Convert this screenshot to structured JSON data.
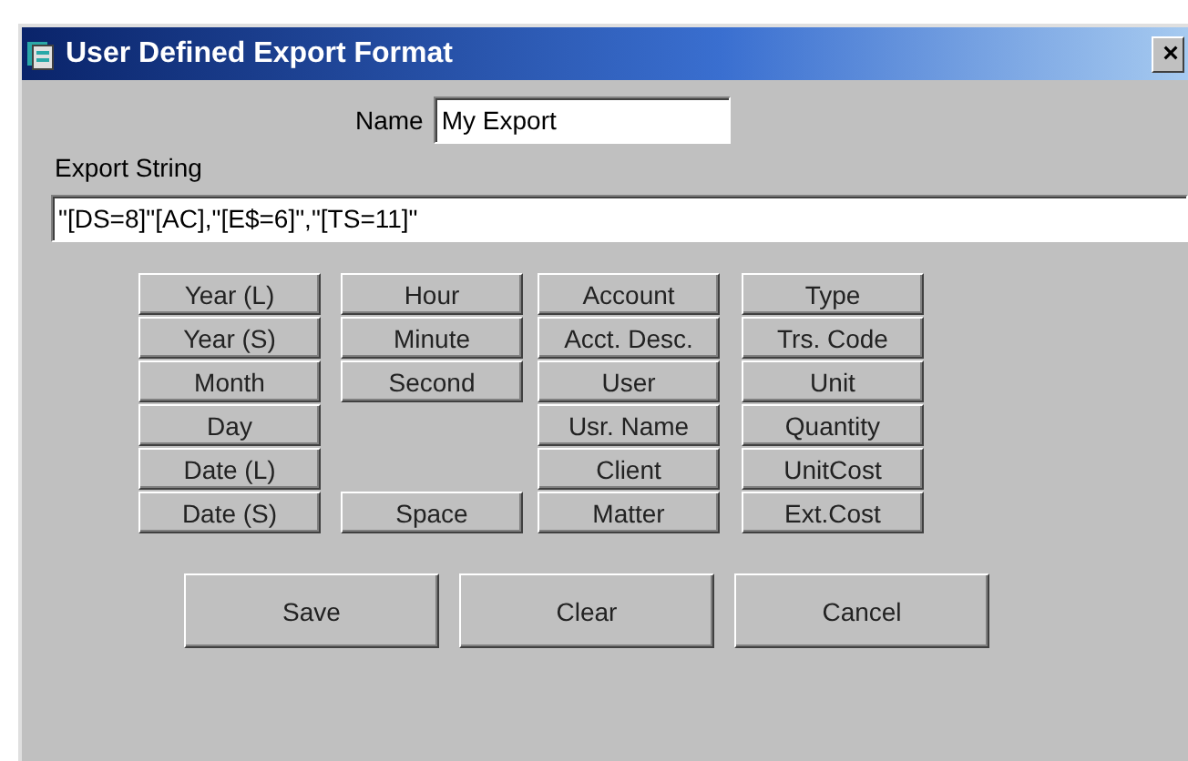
{
  "window": {
    "title": "User Defined Export Format",
    "close": "×"
  },
  "name_field": {
    "label": "Name",
    "value": "My Export"
  },
  "export_string": {
    "label": "Export String",
    "value": "\"[DS=8]\"[AC],\"[E$=6]\",\"[TS=11]\""
  },
  "field_buttons": [
    [
      {
        "kind": "button",
        "label": "Year (L)"
      },
      {
        "kind": "button",
        "label": "Year (S)"
      },
      {
        "kind": "button",
        "label": "Month"
      },
      {
        "kind": "button",
        "label": "Day"
      },
      {
        "kind": "button",
        "label": "Date (L)"
      },
      {
        "kind": "button",
        "label": "Date (S)"
      }
    ],
    [
      {
        "kind": "button",
        "label": "Hour"
      },
      {
        "kind": "button",
        "label": "Minute"
      },
      {
        "kind": "button",
        "label": "Second"
      },
      {
        "kind": "gap"
      },
      {
        "kind": "gap"
      },
      {
        "kind": "button",
        "label": "Space"
      }
    ],
    [
      {
        "kind": "button",
        "label": "Account"
      },
      {
        "kind": "button",
        "label": "Acct. Desc."
      },
      {
        "kind": "button",
        "label": "User"
      },
      {
        "kind": "button",
        "label": "Usr. Name"
      },
      {
        "kind": "button",
        "label": "Client"
      },
      {
        "kind": "button",
        "label": "Matter"
      }
    ],
    [
      {
        "kind": "button",
        "label": "Type"
      },
      {
        "kind": "button",
        "label": "Trs. Code"
      },
      {
        "kind": "button",
        "label": "Unit"
      },
      {
        "kind": "button",
        "label": "Quantity"
      },
      {
        "kind": "button",
        "label": "UnitCost"
      },
      {
        "kind": "button",
        "label": "Ext.Cost"
      }
    ]
  ],
  "buttons": [
    "Save",
    "Clear",
    "Cancel"
  ]
}
